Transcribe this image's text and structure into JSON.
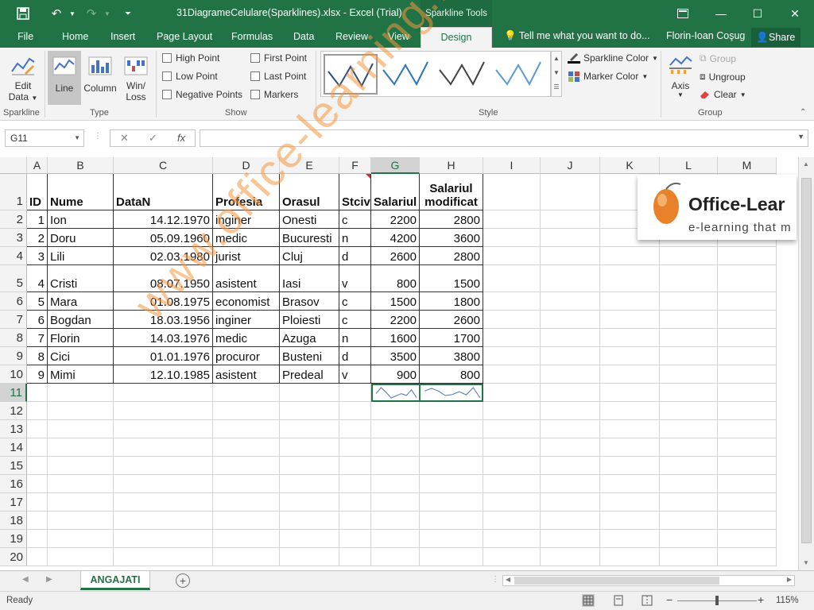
{
  "window": {
    "title": "31DiagrameCelulare(Sparklines).xlsx - Excel (Trial)",
    "context_tool": "Sparkline Tools",
    "user": "Florin-Ioan Coşug",
    "share": "Share",
    "tell_me": "Tell me what you want to do..."
  },
  "tabs": [
    "File",
    "Home",
    "Insert",
    "Page Layout",
    "Formulas",
    "Data",
    "Review",
    "View",
    "Design"
  ],
  "active_tab": "Design",
  "ribbon": {
    "sparkline": {
      "edit_data": "Edit",
      "edit_data2": "Data",
      "label": "Sparkline"
    },
    "type": {
      "line": "Line",
      "column": "Column",
      "winloss": "Win/",
      "winloss2": "Loss",
      "label": "Type"
    },
    "show": {
      "high_point": "High Point",
      "low_point": "Low Point",
      "negative_points": "Negative Points",
      "first_point": "First Point",
      "last_point": "Last Point",
      "markers": "Markers",
      "label": "Show"
    },
    "style": {
      "label": "Style",
      "sparkline_color": "Sparkline Color",
      "marker_color": "Marker Color"
    },
    "group": {
      "axis": "Axis",
      "group": "Group",
      "ungroup": "Ungroup",
      "clear": "Clear",
      "label": "Group"
    }
  },
  "namebox": "G11",
  "fx_label": "fx",
  "columns": [
    "A",
    "B",
    "C",
    "D",
    "E",
    "F",
    "G",
    "H",
    "I",
    "J",
    "K",
    "L",
    "M"
  ],
  "rows": [
    "1",
    "2",
    "3",
    "4",
    "5",
    "6",
    "7",
    "8",
    "9",
    "10",
    "11",
    "12",
    "13",
    "14",
    "15",
    "16",
    "17",
    "18",
    "19",
    "20"
  ],
  "headers": {
    "id": "ID",
    "nume": "Nume",
    "datan": "DataN",
    "profesia": "Profesia",
    "orasul": "Orasul",
    "stciv": "Stciv",
    "salariul": "Salariul",
    "mod1": "Salariul",
    "mod2": "modificat"
  },
  "data": [
    [
      "1",
      "Ion",
      "14.12.1970",
      "inginer",
      "Onesti",
      "c",
      "2200",
      "2800"
    ],
    [
      "2",
      "Doru",
      "05.09.1960",
      "medic",
      "Bucuresti",
      "n",
      "4200",
      "3600"
    ],
    [
      "3",
      "Lili",
      "02.03.1980",
      "jurist",
      "Cluj",
      "d",
      "2600",
      "2800"
    ],
    [
      "4",
      "Cristi",
      "08.07.1950",
      "asistent",
      "Iasi",
      "v",
      "800",
      "1500"
    ],
    [
      "5",
      "Mara",
      "01.08.1975",
      "economist",
      "Brasov",
      "c",
      "1500",
      "1800"
    ],
    [
      "6",
      "Bogdan",
      "18.03.1956",
      "inginer",
      "Ploiesti",
      "c",
      "2200",
      "2600"
    ],
    [
      "7",
      "Florin",
      "14.03.1976",
      "medic",
      "Azuga",
      "n",
      "1600",
      "1700"
    ],
    [
      "8",
      "Cici",
      "01.01.1976",
      "procuror",
      "Busteni",
      "d",
      "3500",
      "3800"
    ],
    [
      "9",
      "Mimi",
      "12.10.1985",
      "asistent",
      "Predeal",
      "v",
      "900",
      "800"
    ]
  ],
  "sparkline_g": [
    2200,
    4200,
    2600,
    800,
    1500,
    2200,
    1600,
    3500,
    900
  ],
  "sparkline_h": [
    2800,
    3600,
    2800,
    1500,
    1800,
    2600,
    1700,
    3800,
    800
  ],
  "sheet": "ANGAJATI",
  "status": {
    "ready": "Ready",
    "zoom": "115%"
  },
  "watermark": "www.office-learning.ro",
  "logo": {
    "name": "Office-Lear",
    "tagline": "e-learning that m"
  },
  "colors": {
    "accent": "#217346",
    "sparkline": "#4472c4"
  }
}
